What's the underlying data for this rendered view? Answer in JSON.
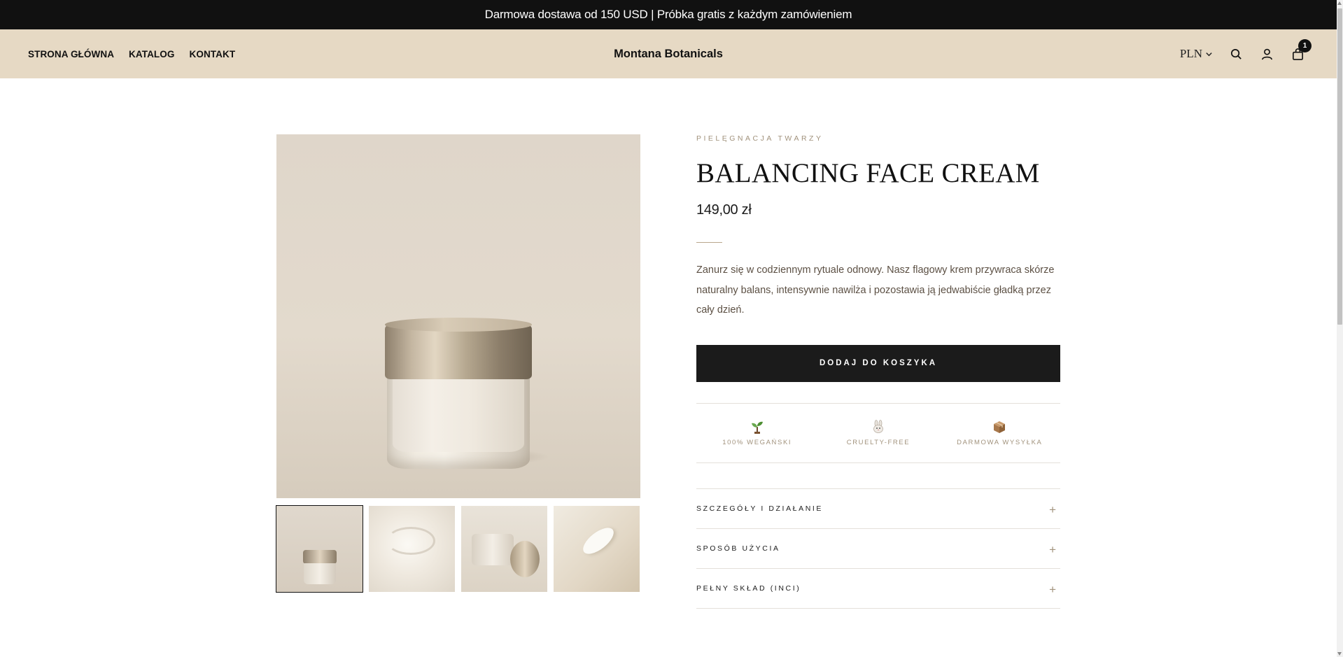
{
  "announcement": {
    "text": "Darmowa dostawa od 150 USD | Próbka gratis z każdym zamówieniem"
  },
  "header": {
    "nav": [
      "STRONA GŁÓWNA",
      "KATALOG",
      "KONTAKT"
    ],
    "brand": "Montana Botanicals",
    "currency": "PLN",
    "icons": [
      "chevron-down-icon",
      "search-icon",
      "user-icon",
      "shopping-bag-icon"
    ],
    "cart_count": "1"
  },
  "product": {
    "category": "PIELĘGNACJA TWARZY",
    "title": "BALANCING FACE CREAM",
    "price": "149,00 zł",
    "description": "Zanurz się w codziennym rytuale odnowy. Nasz flagowy krem przywraca skórze naturalny balans, intensywnie nawilża i pozostawia ją jedwabiście gładką przez cały dzień.",
    "add_to_cart": "DODAJ DO KOSZYKA",
    "badges": [
      {
        "icon": "sprout-icon",
        "label": "100% WEGAŃSKI"
      },
      {
        "icon": "rabbit-icon",
        "label": "CRUELTY-FREE"
      },
      {
        "icon": "package-icon",
        "label": "DARMOWA WYSYŁKA"
      }
    ],
    "accordion": [
      {
        "label": "SZCZEGÓŁY I DZIAŁANIE",
        "icon": "+"
      },
      {
        "label": "SPOSÓB UŻYCIA",
        "icon": "+"
      },
      {
        "label": "PEŁNY SKŁAD (INCI)",
        "icon": "+"
      }
    ],
    "thumbnails": [
      "jar-thumbnail",
      "cream-texture-thumbnail",
      "open-jar-thumbnail",
      "cream-swatch-thumbnail"
    ]
  },
  "colors": {
    "announcement_bg": "#111111",
    "header_bg": "#e6d9c4",
    "accent": "#a1927c",
    "button_bg": "#1b1b1b"
  }
}
